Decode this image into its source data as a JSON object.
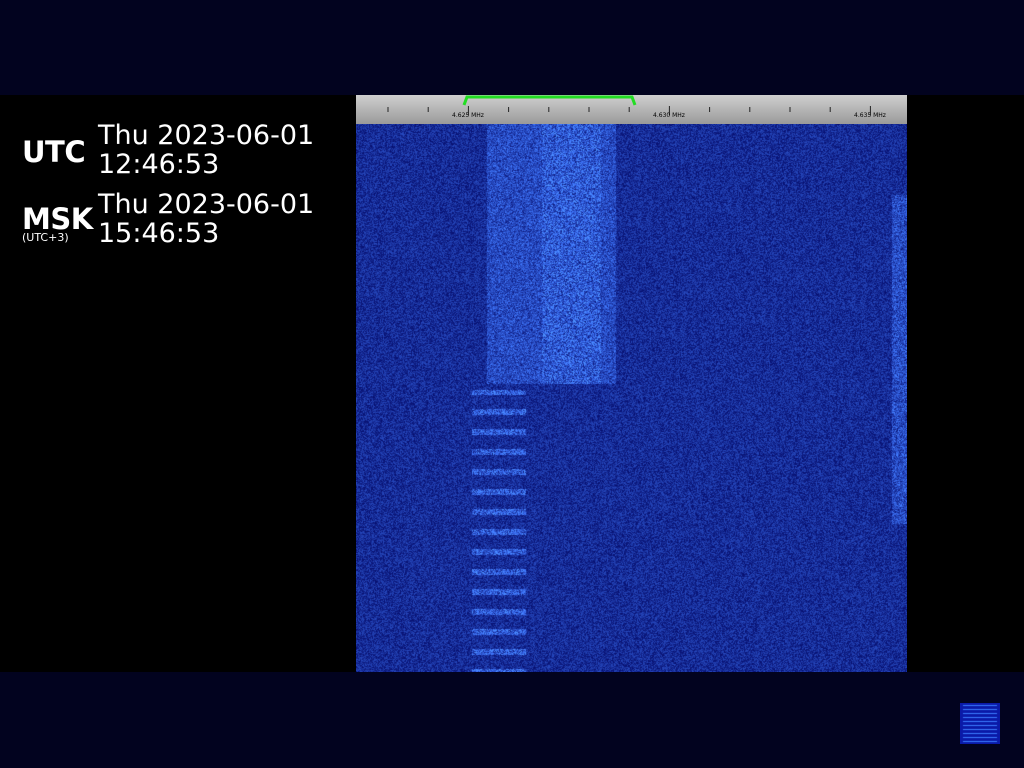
{
  "clocks": [
    {
      "zone": "UTC",
      "sublabel": "",
      "date_line": "Thu 2023-06-01",
      "time_line": "12:46:53"
    },
    {
      "zone": "MSK",
      "sublabel": "(UTC+3)",
      "date_line": "Thu 2023-06-01",
      "time_line": "15:46:53"
    }
  ],
  "scale": {
    "labels": [
      "4.625 MHz",
      "4.630 MHz",
      "4.635 MHz"
    ],
    "passband_color": "#22dd22"
  },
  "colors": {
    "background_band": "#02031f",
    "waterfall_base": "#07108a",
    "waterfall_peak": "#5ab0ff"
  }
}
